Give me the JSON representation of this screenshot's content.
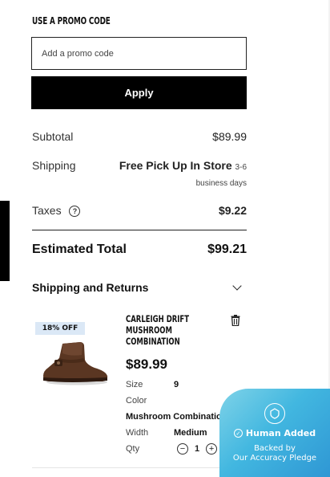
{
  "promo": {
    "heading": "USE A PROMO CODE",
    "placeholder": "Add a promo code",
    "apply_label": "Apply"
  },
  "summary": {
    "subtotal_label": "Subtotal",
    "subtotal_value": "$89.99",
    "shipping_label": "Shipping",
    "shipping_value": "Free Pick Up In Store",
    "shipping_days_a": "3-6",
    "shipping_days_b": "business days",
    "taxes_label": "Taxes",
    "taxes_help_icon": "?",
    "taxes_value": "$9.22",
    "estimated_label": "Estimated Total",
    "estimated_value": "$99.21"
  },
  "shipping_returns": {
    "label": "Shipping and Returns",
    "icon": "chevron-down-icon"
  },
  "product": {
    "badge": "18% OFF",
    "name": "CARLEIGH DRIFT MUSHROOM COMBINATION",
    "price": "$89.99",
    "size_label": "Size",
    "size_value": "9",
    "color_label": "Color",
    "color_value": "Mushroom Combination",
    "width_label": "Width",
    "width_value": "Medium",
    "qty_label": "Qty",
    "qty_value": "1",
    "qty_minus": "−",
    "qty_plus": "+"
  },
  "human_added": {
    "title": "Human Added",
    "subtitle_line1": "Backed by",
    "subtitle_line2": "Our Accuracy Pledge"
  },
  "colors": {
    "primary": "#000000",
    "badge_bg": "#dbe8f6",
    "card_gradient_start": "#7fd3e8",
    "card_gradient_end": "#2f97d4"
  }
}
